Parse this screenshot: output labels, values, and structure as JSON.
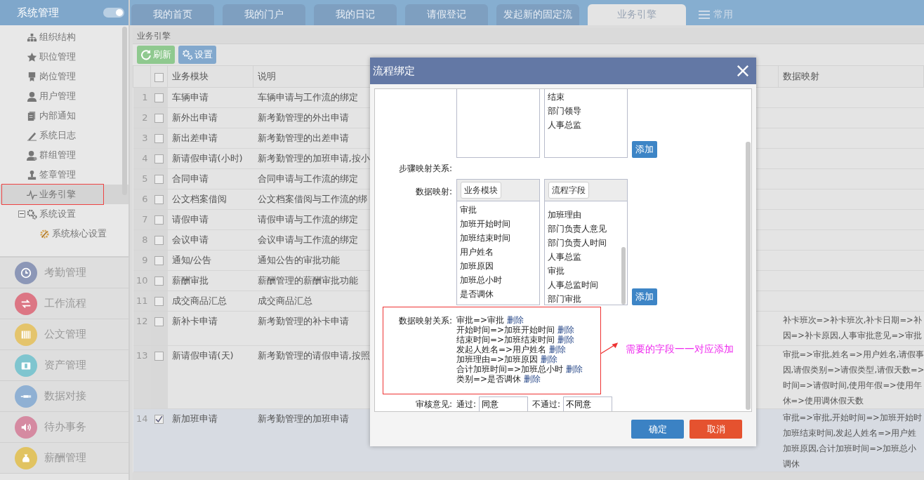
{
  "sidebar": {
    "title": "系统管理",
    "toggle_on": true,
    "tree": [
      {
        "label": "组织结构",
        "kind": "org",
        "selected": false
      },
      {
        "label": "职位管理",
        "kind": "star",
        "selected": false
      },
      {
        "label": "岗位管理",
        "kind": "badge",
        "selected": false
      },
      {
        "label": "用户管理",
        "kind": "user",
        "selected": false
      },
      {
        "label": "内部通知",
        "kind": "doc",
        "selected": false
      },
      {
        "label": "系统日志",
        "kind": "pen",
        "selected": false
      },
      {
        "label": "群组管理",
        "kind": "group",
        "selected": false
      },
      {
        "label": "签章管理",
        "kind": "stamp",
        "selected": false
      },
      {
        "label": "业务引擎",
        "kind": "pulse",
        "selected": true,
        "highlighted": true
      },
      {
        "label": "系统设置",
        "kind": "gears",
        "selected": false,
        "expanded": true,
        "children": [
          {
            "label": "系统核心设置",
            "kind": "gear",
            "selected": false
          }
        ]
      }
    ],
    "modules": [
      {
        "label": "考勤管理",
        "kind": "clock",
        "color": "#8c97b7"
      },
      {
        "label": "工作流程",
        "kind": "swap",
        "color": "#dc7684"
      },
      {
        "label": "公文管理",
        "kind": "piano",
        "color": "#e4c46c"
      },
      {
        "label": "资产管理",
        "kind": "case",
        "color": "#7fc5cf"
      },
      {
        "label": "数据对接",
        "kind": "plug",
        "color": "#8fb0d3"
      },
      {
        "label": "待办事务",
        "kind": "speaker",
        "color": "#d58aa1"
      },
      {
        "label": "薪酬管理",
        "kind": "money",
        "color": "#e1c361"
      }
    ]
  },
  "tabs": [
    {
      "label": "我的首页",
      "kind": "tab",
      "selected": false
    },
    {
      "label": "我的门户",
      "kind": "tab",
      "selected": false
    },
    {
      "label": "我的日记",
      "kind": "tab",
      "selected": false
    },
    {
      "label": "请假登记",
      "kind": "tab",
      "selected": false
    },
    {
      "label": "发起新的固定流",
      "kind": "tab",
      "selected": false
    },
    {
      "label": "业务引擎",
      "kind": "tab",
      "selected": true
    },
    {
      "label": "常用",
      "kind": "menu",
      "selected": false
    }
  ],
  "panel": {
    "title": "业务引擎",
    "toolbar": [
      {
        "label": "刷新",
        "kind": "refresh"
      },
      {
        "label": "设置",
        "kind": "settings"
      }
    ],
    "table": {
      "header_checked": false,
      "columns": [
        "业务模块",
        "说明",
        "数据映射"
      ],
      "rows": [
        {
          "num": "1",
          "checked": false,
          "selected": false,
          "module": "车辆申请",
          "description": "车辆申请与工作流的绑定",
          "mapping": []
        },
        {
          "num": "2",
          "checked": false,
          "selected": false,
          "module": "新外出申请",
          "description": "新考勤管理的外出申请",
          "mapping": []
        },
        {
          "num": "3",
          "checked": false,
          "selected": false,
          "module": "新出差申请",
          "description": "新考勤管理的出差申请",
          "mapping": []
        },
        {
          "num": "4",
          "checked": false,
          "selected": false,
          "module": "新请假申请(小时)",
          "description": "新考勤管理的加班申请,按小",
          "mapping": []
        },
        {
          "num": "5",
          "checked": false,
          "selected": false,
          "module": "合同申请",
          "description": "合同申请与工作流的绑定",
          "mapping": []
        },
        {
          "num": "6",
          "checked": false,
          "selected": false,
          "module": "公文档案借阅",
          "description": "公文档案借阅与工作流的绑",
          "mapping": []
        },
        {
          "num": "7",
          "checked": false,
          "selected": false,
          "module": "请假申请",
          "description": "请假申请与工作流的绑定",
          "mapping": []
        },
        {
          "num": "8",
          "checked": false,
          "selected": false,
          "module": "会议申请",
          "description": "会议申请与工作流的绑定",
          "mapping": []
        },
        {
          "num": "9",
          "checked": false,
          "selected": false,
          "module": "通知/公告",
          "description": "通知公告的审批功能",
          "mapping": []
        },
        {
          "num": "10",
          "checked": false,
          "selected": false,
          "module": "薪酬审批",
          "description": "薪酬管理的薪酬审批功能",
          "mapping": []
        },
        {
          "num": "11",
          "checked": false,
          "selected": false,
          "module": "成交商品汇总",
          "description": "成交商品汇总",
          "mapping": []
        },
        {
          "num": "12",
          "checked": false,
          "selected": false,
          "module": "新补卡申请",
          "description": "新考勤管理的补卡申请",
          "mapping": [
            "补卡班次=>补卡班次,补卡日期=>补",
            "因=>补卡原因,人事审批意见=>审批"
          ]
        },
        {
          "num": "13",
          "checked": false,
          "selected": false,
          "module": "新请假申请(天)",
          "description": "新考勤管理的请假申请,按照",
          "mapping": [
            "审批=>审批,姓名=>用户姓名,请假事",
            "因,请假类别=>请假类型,请假天数=>",
            "时间=>请假时间,使用年假=>使用年",
            "休=>使用调休假天数"
          ]
        },
        {
          "num": "14",
          "checked": true,
          "selected": true,
          "module": "新加班申请",
          "description": "新考勤管理的加班申请",
          "mapping": [
            "审批=>审批,开始时间=>加班开始时",
            "加班结束时间,发起人姓名=>用户姓",
            "加班原因,合计加班时间=>加班总小",
            "调休"
          ]
        }
      ]
    }
  },
  "dialog": {
    "title": "流程绑定",
    "step_right": [
      "结束",
      "部门领导",
      "人事总监"
    ],
    "add_label": "添加",
    "step_label": "步骤映射关系:",
    "data_label": "数据映射:",
    "module_header": "业务模块",
    "field_header": "流程字段",
    "module_fields": [
      "审批",
      "加班开始时间",
      "加班结束时间",
      "用户姓名",
      "加班原因",
      "加班总小时",
      "是否调休"
    ],
    "flow_fields": [
      "加班理由",
      "部门负责人意见",
      "部门负责人时间",
      "人事总监",
      "审批",
      "人事总监时间",
      "部门审批"
    ],
    "add_label_2": "添加",
    "mapping_label": "数据映射关系:",
    "mappings": [
      {
        "text": "审批=>审批",
        "action": "删除"
      },
      {
        "text": "开始时间=>加班开始时间",
        "action": "删除"
      },
      {
        "text": "结束时间=>加班结束时间",
        "action": "删除"
      },
      {
        "text": "发起人姓名=>用户姓名",
        "action": "删除"
      },
      {
        "text": "加班理由=>加班原因",
        "action": "删除"
      },
      {
        "text": "合计加班时间=>加班总小时",
        "action": "删除"
      },
      {
        "text": "类别=>是否调休",
        "action": "删除"
      }
    ],
    "highlighted": true,
    "annotation": "需要的字段一一对应添加",
    "review": {
      "label": "审核意见:",
      "pass_label": "通过:",
      "pass_value": "同意",
      "fail_label": "不通过:",
      "fail_value": "不同意"
    },
    "buttons": [
      {
        "label": "确定",
        "kind": "primary"
      },
      {
        "label": "取消",
        "kind": "danger"
      }
    ]
  }
}
